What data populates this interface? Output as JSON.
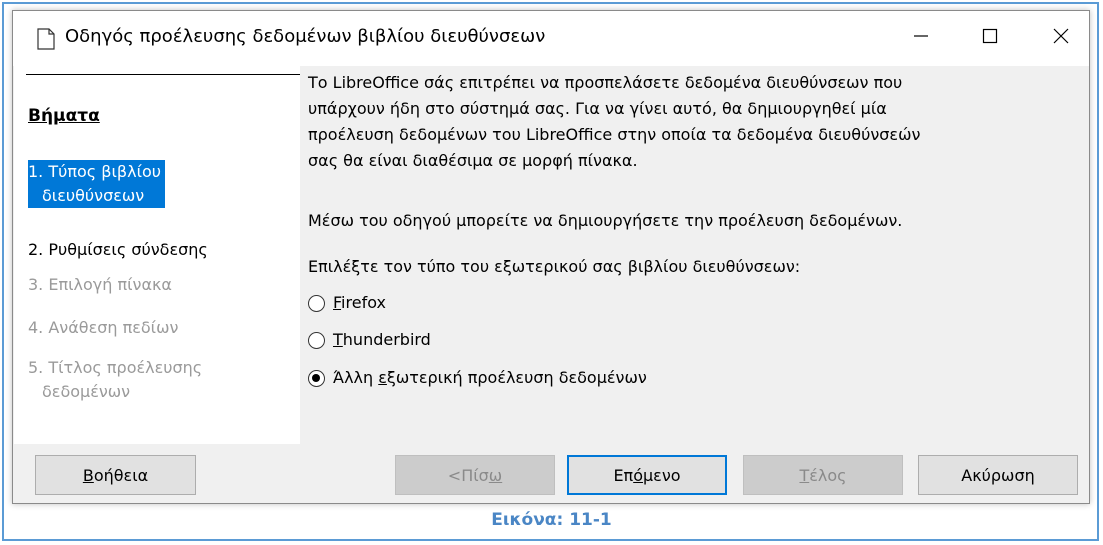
{
  "window": {
    "title": "Οδηγός προέλευσης δεδομένων βιβλίου διευθύνσεων",
    "icon": "document-icon"
  },
  "sidebar": {
    "heading": "Βήματα",
    "steps": [
      {
        "line1": "1. Τύπος βιβλίου",
        "line2": "διευθύνσεων",
        "state": "active"
      },
      {
        "line1": "2. Ρυθμίσεις σύνδεσης",
        "line2": "",
        "state": "enabled"
      },
      {
        "line1": "3. Επιλογή πίνακα",
        "line2": "",
        "state": "disabled"
      },
      {
        "line1": "4. Ανάθεση πεδίων",
        "line2": "",
        "state": "disabled"
      },
      {
        "line1": "5. Τίτλος προέλευσης",
        "line2": "δεδομένων",
        "state": "disabled"
      }
    ]
  },
  "content": {
    "intro_lines": [
      "Το LibreOffice σάς επιτρέπει να προσπελάσετε δεδομένα διευθύνσεων που",
      "υπάρχουν ήδη στο σύστημά σας. Για να γίνει αυτό, θα δημιουργηθεί μία",
      "προέλευση δεδομένων του LibreOffice στην οποία τα δεδομένα διευθύνσεών",
      "σας θα είναι διαθέσιμα σε μορφή πίνακα."
    ],
    "wizard_note": "Μέσω του οδηγού μπορείτε να δημιουργήσετε την προέλευση δεδομένων.",
    "choose_label": "Επιλέξτε τον τύπο του εξωτερικού σας βιβλίου διευθύνσεων:",
    "options": [
      {
        "mnemonic": "F",
        "rest": "irefox",
        "checked": false
      },
      {
        "mnemonic": "T",
        "rest": "hunderbird",
        "checked": false
      },
      {
        "pre": "Άλλη ",
        "mnemonic": "ε",
        "rest": "ξωτερική προέλευση δεδομένων",
        "checked": true
      }
    ]
  },
  "buttons": {
    "help": {
      "mnemonic": "Β",
      "rest": "οήθεια"
    },
    "back": {
      "pre": "<Πίσ",
      "mnemonic": "ω"
    },
    "next": {
      "pre": "Επ",
      "mnemonic": "ό",
      "rest": "μενο"
    },
    "finish": {
      "mnemonic": "Τ",
      "rest": "έλος"
    },
    "cancel": "Ακύρωση"
  },
  "caption": "Εικόνα: 11-1",
  "colors": {
    "accent": "#0078d7",
    "caption": "#4a86c5",
    "frame": "#5b9bd5"
  }
}
